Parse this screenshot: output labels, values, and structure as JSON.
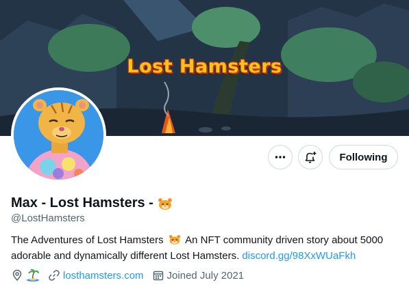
{
  "banner": {
    "title": "Lost Hamsters"
  },
  "profile": {
    "display_name": "Max - Lost Hamsters -",
    "name_emoji": "hamster-emoji",
    "handle": "@LostHamsters",
    "bio_text_1": "The Adventures of Lost Hamsters",
    "bio_emoji": "hamster-emoji",
    "bio_text_2": " An NFT community driven story about 5000 adorable and dynamically different Lost Hamsters. ",
    "bio_link": "discord.gg/98XxWUaFkh",
    "location_emoji": "island-emoji",
    "website": "losthamsters.com",
    "joined": "Joined July 2021"
  },
  "actions": {
    "more_icon": "more-horizontal-icon",
    "notify_icon": "bell-plus-icon",
    "follow_label": "Following"
  },
  "colors": {
    "link": "#1d9bf0",
    "secondary_text": "#536471",
    "avatar_bg": "#3a96e6",
    "banner_title": "#ffc21a"
  }
}
